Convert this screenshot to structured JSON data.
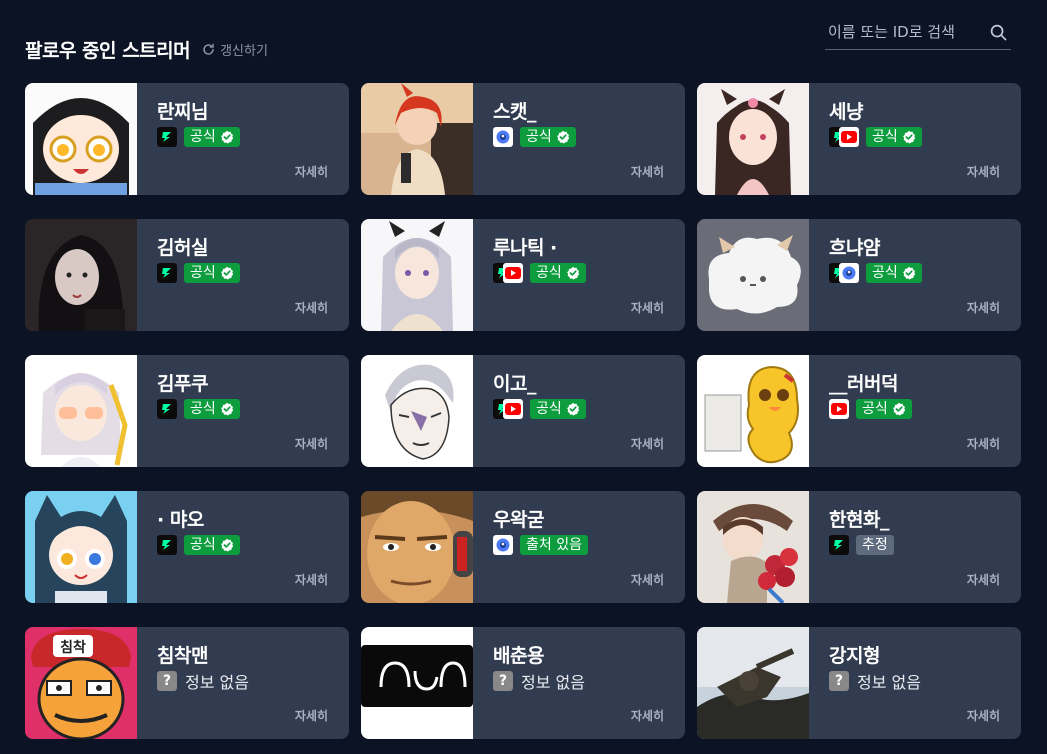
{
  "header": {
    "title": "팔로우 중인 스트리머",
    "refresh_label": "갱신하기"
  },
  "search": {
    "placeholder": "이름 또는 ID로 검색"
  },
  "detail_label": "자세히",
  "cards": [
    {
      "name": "란찌님",
      "status": "공식",
      "platforms": [
        "chzzk"
      ]
    },
    {
      "name": "스캣_",
      "status": "공식",
      "platforms": [
        "soop"
      ]
    },
    {
      "name": "세냥",
      "status": "공식",
      "platforms": [
        "chzzk",
        "youtube"
      ]
    },
    {
      "name": "김허실",
      "status": "공식",
      "platforms": [
        "chzzk"
      ]
    },
    {
      "name": "루나틱 ·",
      "status": "공식",
      "platforms": [
        "chzzk",
        "youtube"
      ]
    },
    {
      "name": "흐냐얌",
      "status": "공식",
      "platforms": [
        "chzzk",
        "soop"
      ]
    },
    {
      "name": "김푸쿠",
      "status": "공식",
      "platforms": [
        "chzzk"
      ]
    },
    {
      "name": "이고_",
      "status": "공식",
      "platforms": [
        "chzzk",
        "youtube"
      ]
    },
    {
      "name": "__러버덕",
      "status": "공식",
      "platforms": [
        "youtube"
      ]
    },
    {
      "name": "· 먀오",
      "status": "공식",
      "platforms": [
        "chzzk"
      ]
    },
    {
      "name": "우왁굳",
      "status": "출처 있음",
      "platforms": [
        "soop"
      ]
    },
    {
      "name": "한현화_",
      "status": "추정",
      "platforms": [
        "chzzk"
      ]
    },
    {
      "name": "침착맨",
      "status": "정보 없음",
      "platforms": []
    },
    {
      "name": "배춘용",
      "status": "정보 없음",
      "platforms": []
    },
    {
      "name": "강지형",
      "status": "정보 없음",
      "platforms": []
    }
  ],
  "colors": {
    "background": "#0c1324",
    "card": "#313c50",
    "official_green": "#0d9d3e",
    "guess_gray": "#5e6a7d",
    "unknown_gray": "#888888"
  },
  "icons": {
    "refresh": "refresh-icon",
    "search": "search-icon",
    "chzzk": "chzzk-logo-icon",
    "youtube": "youtube-logo-icon",
    "soop": "soop-logo-icon",
    "verified": "verified-check-icon",
    "unknown": "question-mark-icon"
  }
}
